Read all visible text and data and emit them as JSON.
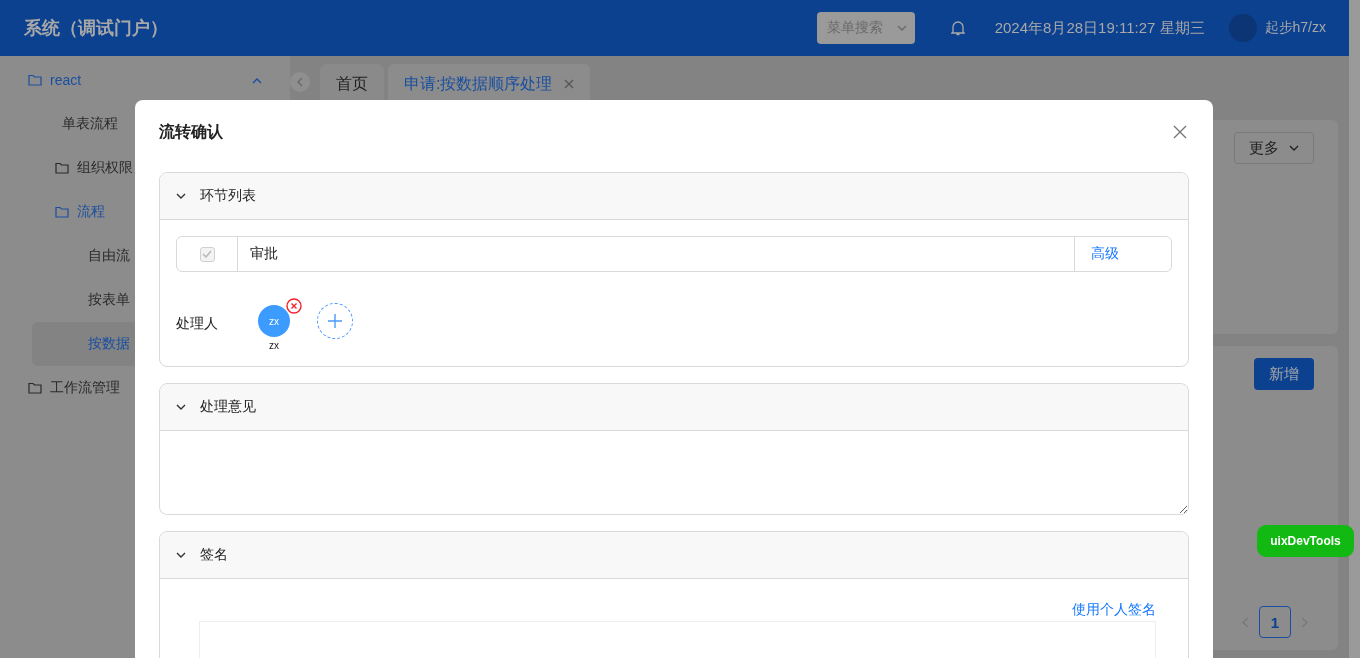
{
  "header": {
    "title": "系统（调试门户）",
    "menu_search": {
      "placeholder": "菜单搜索"
    },
    "datetime": "2024年8月28日19:11:27 星期三",
    "user": "起步h7/zx"
  },
  "sidebar": {
    "items": [
      {
        "label": "react",
        "kind": "folder",
        "expanded": true,
        "selected": false,
        "children": [
          {
            "label": "单表流程",
            "kind": "page",
            "selected": false
          },
          {
            "label": "组织权限",
            "kind": "folder",
            "expanded": false,
            "selected": false
          },
          {
            "label": "流程",
            "kind": "folder",
            "expanded": true,
            "selected": false,
            "children": [
              {
                "label": "自由流",
                "kind": "page",
                "selected": false
              },
              {
                "label": "按表单",
                "kind": "page",
                "selected": false
              },
              {
                "label": "按数据",
                "kind": "page",
                "selected": true
              }
            ]
          }
        ]
      },
      {
        "label": "工作流管理",
        "kind": "folder",
        "expanded": false,
        "selected": false
      }
    ]
  },
  "tabs": [
    {
      "label": "首页",
      "selected": false,
      "closable": false
    },
    {
      "label": "申请:按数据顺序处理",
      "selected": true,
      "closable": true
    }
  ],
  "background": {
    "more_button": "更多",
    "add_button": "新增",
    "pagination": [
      {
        "label": "1",
        "selected": true
      }
    ]
  },
  "devtools_button": "uixDevTools",
  "modal": {
    "title": "流转确认",
    "sections": [
      {
        "kind": "steps",
        "title": "环节列表",
        "expanded": true,
        "steps": [
          {
            "checked": true,
            "disabled": true,
            "name": "审批",
            "action": "高级"
          }
        ],
        "handlers_label": "处理人",
        "people": [
          {
            "initials": "zx",
            "name": "zx"
          }
        ]
      },
      {
        "kind": "opinion",
        "title": "处理意见",
        "expanded": true
      },
      {
        "kind": "signature",
        "title": "签名",
        "expanded": true,
        "link": "使用个人签名"
      }
    ]
  }
}
